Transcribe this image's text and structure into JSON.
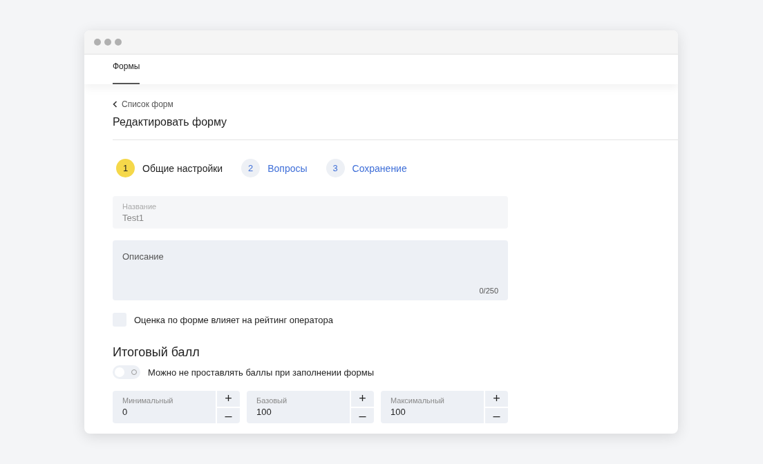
{
  "tabs": [
    {
      "label": "Формы",
      "selected": true
    }
  ],
  "breadcrumb": "Список форм",
  "title": "Редактировать форму",
  "steps": [
    {
      "number": "1",
      "label": "Общие настройки",
      "selected": true
    },
    {
      "number": "2",
      "label": "Вопросы",
      "selected": false
    },
    {
      "number": "3",
      "label": "Сохранение",
      "selected": false
    }
  ],
  "name_field": {
    "label": "Название",
    "value": "Test1",
    "disabled": true
  },
  "description_field": {
    "placeholder": "Описание",
    "counter": "0/250"
  },
  "rating_checkbox": {
    "label": "Оценка по форме влияет на рейтинг оператора",
    "checked": false
  },
  "score_heading": "Итоговый балл",
  "optional_toggle": {
    "label": "Можно не проставлять баллы при заполнении формы",
    "on": false
  },
  "score_fields": [
    {
      "label": "Минимальный",
      "value": "0",
      "plus": "+",
      "minus": "–"
    },
    {
      "label": "Базовый",
      "value": "100",
      "plus": "+",
      "minus": "–"
    },
    {
      "label": "Максимальный",
      "value": "100",
      "plus": "+",
      "minus": "–"
    }
  ]
}
